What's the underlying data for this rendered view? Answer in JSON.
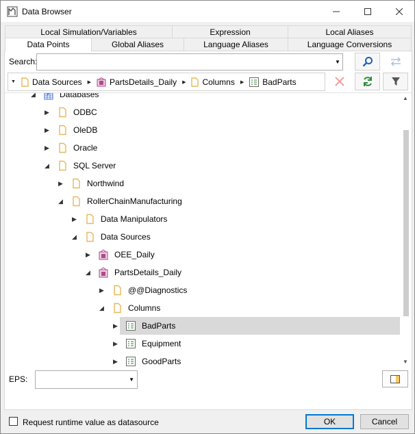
{
  "window": {
    "title": "Data Browser"
  },
  "tabs": {
    "top_row": [
      "Local Simulation/Variables",
      "Expression",
      "Local Aliases"
    ],
    "bottom_row": [
      "Data Points",
      "Global Aliases",
      "Language Aliases",
      "Language Conversions"
    ],
    "active": "Data Points"
  },
  "search": {
    "label": "Search:",
    "value": ""
  },
  "breadcrumb": [
    "Data Sources",
    "PartsDetails_Daily",
    "Columns",
    "BadParts"
  ],
  "tree": [
    {
      "label": "Databases",
      "state": "expanded",
      "icon": "database-icon"
    },
    {
      "label": "ODBC",
      "state": "collapsed",
      "icon": "folder-icon"
    },
    {
      "label": "OleDB",
      "state": "collapsed",
      "icon": "folder-icon"
    },
    {
      "label": "Oracle",
      "state": "collapsed",
      "icon": "folder-icon"
    },
    {
      "label": "SQL Server",
      "state": "expanded",
      "icon": "folder-icon"
    },
    {
      "label": "Northwind",
      "state": "collapsed",
      "icon": "folder-icon"
    },
    {
      "label": "RollerChainManufacturing",
      "state": "expanded",
      "icon": "folder-icon"
    },
    {
      "label": "Data Manipulators",
      "state": "collapsed",
      "icon": "folder-icon"
    },
    {
      "label": "Data Sources",
      "state": "expanded",
      "icon": "folder-icon"
    },
    {
      "label": "OEE_Daily",
      "state": "collapsed",
      "icon": "datasource-icon"
    },
    {
      "label": "PartsDetails_Daily",
      "state": "expanded",
      "icon": "datasource-icon"
    },
    {
      "label": "@@Diagnostics",
      "state": "collapsed",
      "icon": "folder-icon"
    },
    {
      "label": "Columns",
      "state": "expanded",
      "icon": "folder-icon"
    },
    {
      "label": "BadParts",
      "state": "collapsed",
      "icon": "column-icon",
      "selected": true
    },
    {
      "label": "Equipment",
      "state": "collapsed",
      "icon": "column-icon"
    },
    {
      "label": "GoodParts",
      "state": "collapsed",
      "icon": "column-icon"
    }
  ],
  "eps": {
    "label": "EPS:",
    "value": ""
  },
  "footer": {
    "checkbox_label": "Request runtime value as datasource",
    "checkbox_checked": false,
    "ok_label": "OK",
    "cancel_label": "Cancel"
  },
  "colors": {
    "selection": "#d9d9d9",
    "accent": "#0078d7",
    "folder": "#e6b85c",
    "datasource": "#b04a8a",
    "database": "#3a6fd8"
  }
}
